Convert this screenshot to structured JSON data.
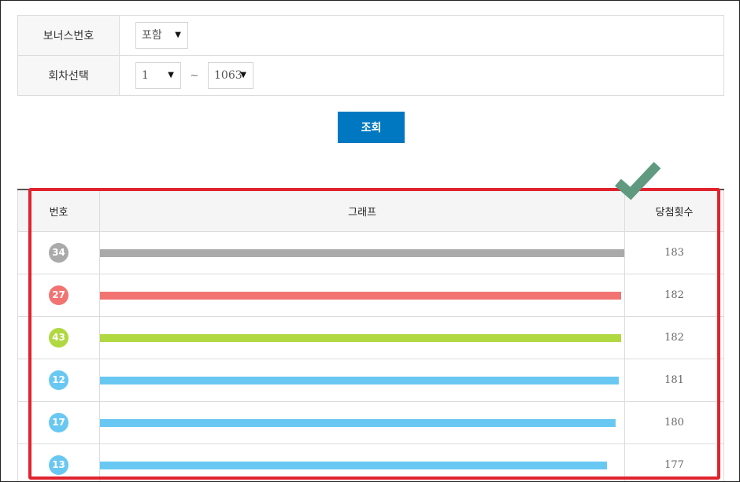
{
  "filter": {
    "bonus_label": "보너스번호",
    "bonus_value": "포함",
    "round_label": "회차선택",
    "round_from": "1",
    "round_separator": "~",
    "round_to": "1063"
  },
  "search_button": "조회",
  "table": {
    "headers": {
      "number": "번호",
      "graph": "그래프",
      "count": "당첨횟수"
    },
    "max_count": 183,
    "rows": [
      {
        "number": "34",
        "count": "183",
        "value": 183,
        "color": "#aaaaaa"
      },
      {
        "number": "27",
        "count": "182",
        "value": 182,
        "color": "#f27472"
      },
      {
        "number": "43",
        "count": "182",
        "value": 182,
        "color": "#b0d840"
      },
      {
        "number": "12",
        "count": "181",
        "value": 181,
        "color": "#69c8f2"
      },
      {
        "number": "17",
        "count": "180",
        "value": 180,
        "color": "#69c8f2"
      },
      {
        "number": "13",
        "count": "177",
        "value": 177,
        "color": "#69c8f2"
      }
    ]
  },
  "colors": {
    "accent": "#0078c1",
    "highlight": "#e0232e",
    "check": "#5f9a80"
  },
  "icons": {
    "dropdown": "caret-down-icon",
    "check": "check-mark-icon"
  }
}
